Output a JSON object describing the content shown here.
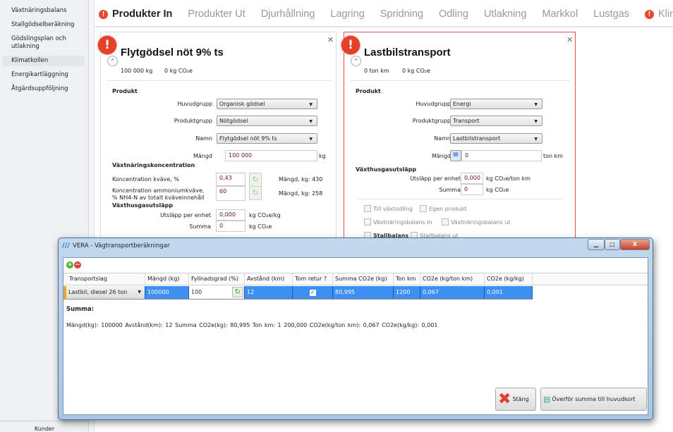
{
  "sidebar": {
    "items": [
      "Växtnäringsbalans",
      "Stallgödselberäkning",
      "Gödslingsplan och utlakning",
      "Klimatkollen",
      "Energikartläggning",
      "Åtgärdsuppföljning"
    ],
    "active": "Klimatkollen",
    "footer": "Kunder"
  },
  "tabs": [
    {
      "label": "Produkter In",
      "active": true,
      "warning": true
    },
    {
      "label": "Produkter Ut"
    },
    {
      "label": "Djurhållning"
    },
    {
      "label": "Lagring"
    },
    {
      "label": "Spridning"
    },
    {
      "label": "Odling"
    },
    {
      "label": "Utlakning"
    },
    {
      "label": "Markkol"
    },
    {
      "label": "Lustgas"
    },
    {
      "label": "Klimatr",
      "warning": true
    }
  ],
  "card1": {
    "title": "Flytgödsel nöt 9% ts",
    "amount": "100 000 kg",
    "co2": "0 kg CO₂e",
    "section_produkt": "Produkt",
    "huvudgrupp_label": "Huvudgrupp",
    "huvudgrupp": "Organisk gödsel",
    "produktgrupp_label": "Produktgrupp",
    "produktgrupp": "Nötgödsel",
    "namn_label": "Namn",
    "namn": "Flytgödsel nöt 9% ts",
    "mangd_label": "Mängd",
    "mangd": "100 000",
    "mangd_unit": "kg",
    "section_vaxt": "Växtnäringskoncentration",
    "kvave_label": "Koncentration kväve, %",
    "kvave": "0,43",
    "kvave_mangd": "Mängd, kg: 430",
    "ammonium_label1": "Koncentration ammoniumkväve,",
    "ammonium_label2": "% NH4-N av totalt kväveinnehåll",
    "ammonium": "60",
    "ammonium_mangd": "Mängd, kg: 258",
    "section_gas": "Växthusgasutsläpp",
    "utslapp_label": "Utsläpp per enhet",
    "utslapp": "0,000",
    "utslapp_unit": "kg CO₂e/kg",
    "summa_label": "Summa",
    "summa": "0",
    "summa_unit": "kg CO₂e"
  },
  "card2": {
    "title": "Lastbilstransport",
    "amount": "0 ton km",
    "co2": "0 kg CO₂e",
    "section_produkt": "Produkt",
    "huvudgrupp_label": "Huvudgrupp",
    "huvudgrupp": "Energi",
    "produktgrupp_label": "Produktgrupp",
    "produktgrupp": "Transport",
    "namn_label": "Namn",
    "namn": "Lastbilstransport",
    "mangd_label": "Mängd",
    "mangd": "0",
    "mangd_unit": "ton km",
    "section_gas": "Växthusgasutsläpp",
    "utslapp_label": "Utsläpp per enhet",
    "utslapp": "0,000",
    "utslapp_unit": "kg CO₂e/ton km",
    "summa_label": "Summa",
    "summa": "0",
    "summa_unit": "kg CO₂e",
    "checks": [
      "Till växtodling",
      "Egen produkt",
      "Växtnäringsbalans in",
      "Växtnäringsbalans ut",
      "Stallbalans in",
      "Stallbalans ut"
    ]
  },
  "dialog": {
    "title": "VERA - Vägtransportberäkningar",
    "columns": [
      "Transportslag",
      "Mängd (kg)",
      "Fyllnadsgrad (%)",
      "Avstånd (km)",
      "Tom retur ?",
      "Summa CO2e (kg)",
      "Ton km",
      "CO2e (kg/ton km)",
      "CO2e (kg/kg)"
    ],
    "row": {
      "transportslag": "Lastbil, diesel 26 ton",
      "mangd": "100000",
      "fyllnadsgrad": "100",
      "avstand": "12",
      "tom_retur": true,
      "summa": "80,995",
      "tonkm": "1200",
      "co2_tonkm": "0,067",
      "co2_kg": "0,001"
    },
    "summa_heading": "Summa:",
    "summa_line": "Mängd(kg):  100000   Avstånd(km):  12   Summa CO2e(kg):  80,995   Ton km:  1 200,000   CO2e(kg/ton km):  0,067   CO2e(kg/kg):  0,001",
    "close_label": "Stäng",
    "transfer_label": "Överför summa till huvudkort"
  },
  "colors": {
    "accent": "#3d8ff2",
    "warning": "#e5402a"
  }
}
